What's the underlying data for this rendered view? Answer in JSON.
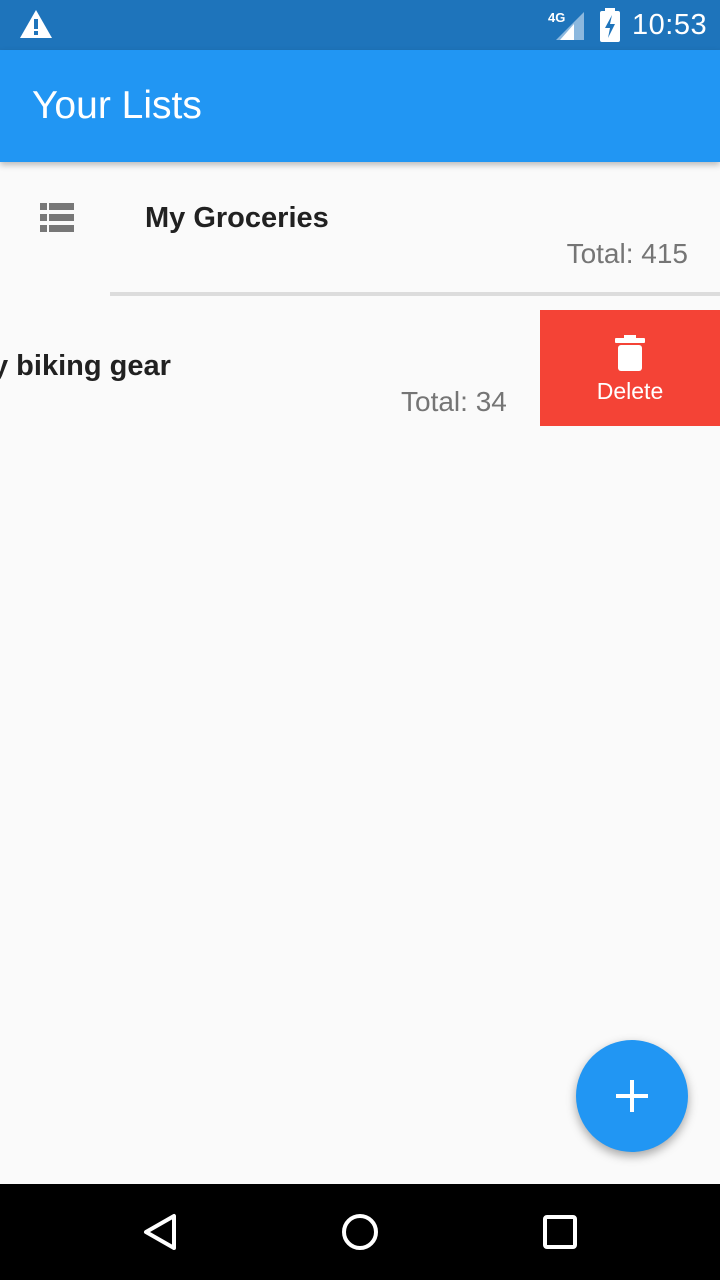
{
  "status_bar": {
    "time": "10:53",
    "network": "4G",
    "icons": [
      "warning-icon",
      "signal-icon",
      "battery-charging-icon"
    ]
  },
  "app_bar": {
    "title": "Your Lists"
  },
  "lists": [
    {
      "name": "My Groceries",
      "total": "Total: 415",
      "icon": "list-icon"
    },
    {
      "name": "My biking gear",
      "visible_name": "y biking gear",
      "total": "Total: 34"
    }
  ],
  "swipe_action": {
    "label": "Delete",
    "icon": "trash-icon",
    "color": "#f44336"
  },
  "fab": {
    "icon": "plus-icon",
    "color": "#2196f3"
  },
  "colors": {
    "primary": "#2196f3",
    "status_bar": "#1e74bb",
    "background": "#fafafa"
  },
  "nav_bar": {
    "icons": [
      "back-icon",
      "home-icon",
      "recents-icon"
    ]
  }
}
